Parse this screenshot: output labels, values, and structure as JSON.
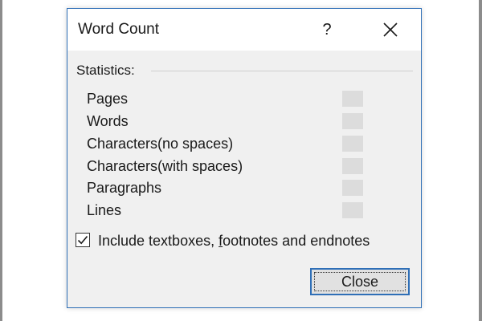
{
  "dialog": {
    "title": "Word Count",
    "help_label": "?",
    "close_icon": "close-icon"
  },
  "statistics": {
    "heading": "Statistics:",
    "rows": [
      {
        "label": "Pages",
        "value": ""
      },
      {
        "label": "Words",
        "value": ""
      },
      {
        "label": "Characters(no spaces)",
        "value": ""
      },
      {
        "label": "Characters(with spaces)",
        "value": ""
      },
      {
        "label": "Paragraphs",
        "value": ""
      },
      {
        "label": "Lines",
        "value": ""
      }
    ]
  },
  "include_option": {
    "label_before": "Include textboxes, ",
    "label_mnemonic": "f",
    "label_after": "ootnotes and endnotes",
    "checked": true
  },
  "buttons": {
    "close_label": "Close"
  },
  "colors": {
    "dialog_border": "#2f6fb7",
    "dialog_bg": "#f0f0f0",
    "value_placeholder": "#dcdcdc"
  }
}
